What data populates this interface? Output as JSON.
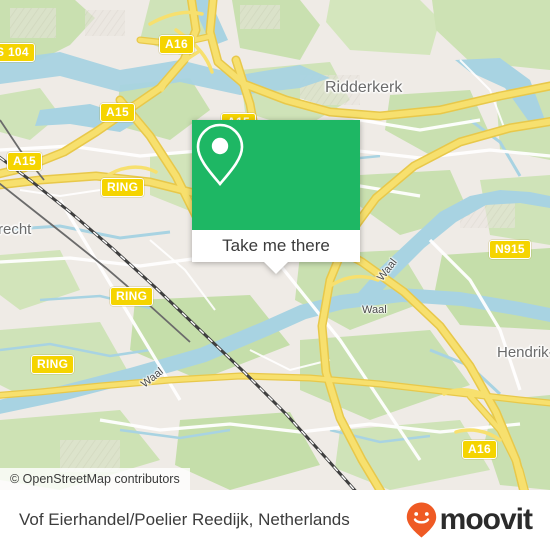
{
  "map": {
    "place_labels": [
      {
        "name": "Ridderkerk",
        "text": "Ridderkerk"
      },
      {
        "name": "recht",
        "text": "recht"
      },
      {
        "name": "Hendrik",
        "text": "Hendrik-"
      }
    ],
    "road_shields": [
      {
        "name": "s104",
        "text": "S 104"
      },
      {
        "name": "a16-top",
        "text": "A16"
      },
      {
        "name": "a15-right",
        "text": "A15"
      },
      {
        "name": "a15-left",
        "text": "A15"
      },
      {
        "name": "a15-behind-card",
        "text": "A15"
      },
      {
        "name": "ring-upper",
        "text": "RING"
      },
      {
        "name": "ring-mid",
        "text": "RING"
      },
      {
        "name": "ring-lower",
        "text": "RING"
      },
      {
        "name": "n915",
        "text": "N915"
      },
      {
        "name": "a16-bottom",
        "text": "A16"
      }
    ],
    "river_labels": [
      {
        "name": "waal-left",
        "text": "Waal"
      },
      {
        "name": "waal-mid",
        "text": "Waal"
      },
      {
        "name": "waal-right",
        "text": "Waal"
      }
    ],
    "colors": {
      "land": "#efebe6",
      "green": "#c9e0b0",
      "green_dark": "#bcd9a0",
      "water": "#a8d3e2",
      "highway": "#f7e06e",
      "highway_casing": "#e8c84a",
      "road_white": "#ffffff",
      "rail": "#4a4a4a",
      "shield_fill": "#f5d400"
    }
  },
  "callout": {
    "icon": "map-pin-icon",
    "button_label": "Take me there",
    "accent_color": "#1eb764"
  },
  "attribution": {
    "text": "© OpenStreetMap contributors"
  },
  "footer": {
    "title": "Vof Eierhandel/Poelier Reedijk, Netherlands",
    "logo_text": "moovit",
    "logo_icon": "moovit-pin-smiley-icon",
    "logo_color": "#ef5a24"
  }
}
